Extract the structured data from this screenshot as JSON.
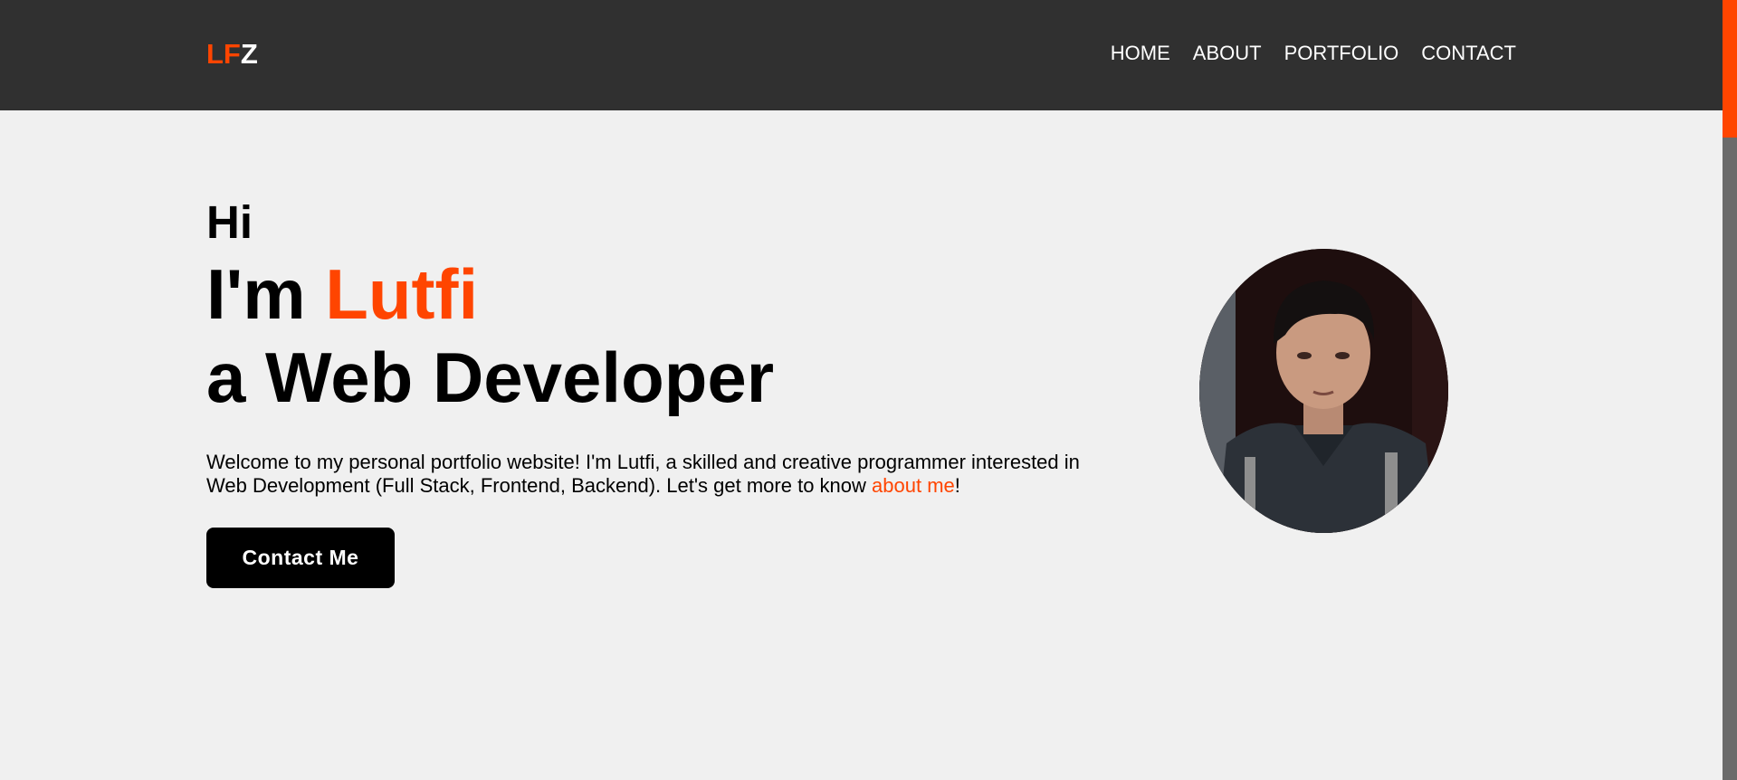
{
  "header": {
    "logo_part1": "LF",
    "logo_part2": "Z",
    "nav": [
      "HOME",
      "ABOUT",
      "PORTFOLIO",
      "CONTACT"
    ]
  },
  "hero": {
    "greeting": "Hi",
    "intro_prefix": "I'm ",
    "name": "Lutfi",
    "role": "a Web Developer",
    "description_prefix": "Welcome to my personal portfolio website! I'm Lutfi, a skilled and creative programmer interested in Web Development (Full Stack, Frontend, Backend). Let's get more to know ",
    "description_link": "about me",
    "description_suffix": "!",
    "button_label": "Contact Me",
    "photo_icon": "profile-photo"
  },
  "colors": {
    "accent": "#ff4500",
    "header_bg": "#303030",
    "page_bg": "#f0f0f0"
  }
}
